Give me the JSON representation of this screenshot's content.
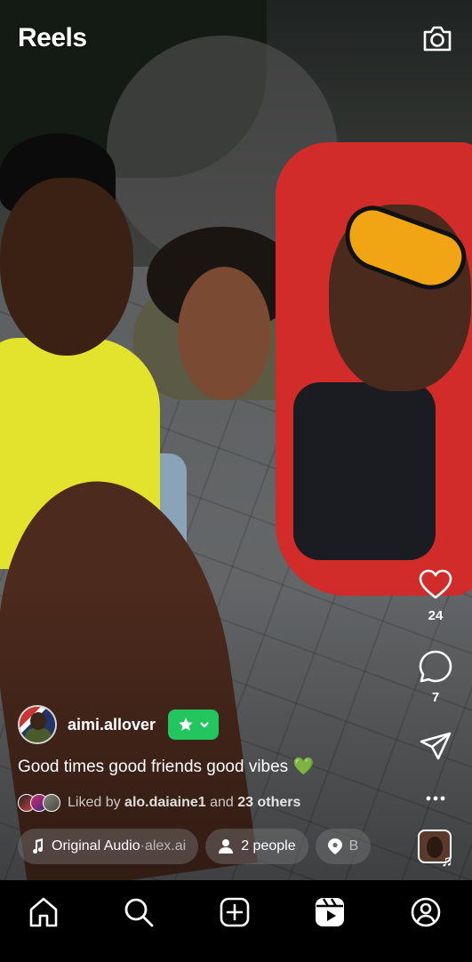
{
  "header": {
    "title": "Reels"
  },
  "actions": {
    "like_count": "24",
    "comment_count": "7"
  },
  "post": {
    "username": "aimi.allover",
    "caption": "Good times good friends good vibes",
    "caption_emoji": "💚",
    "liked_prefix": "Liked by",
    "liked_user": "alo.daiaine1",
    "liked_and": "and",
    "liked_others": "23 others"
  },
  "chips": {
    "audio_label": "Original Audio",
    "audio_separator": " · ",
    "audio_artist": "alex.ai",
    "people_label": "2 people",
    "location_label": "B"
  },
  "colors": {
    "badge_green": "#22c55e",
    "heart_green": "#3ecf4b"
  },
  "icons": {
    "header": "camera-icon",
    "rail": [
      "heart-icon",
      "comment-icon",
      "share-icon",
      "more-icon"
    ],
    "nav": [
      "home-icon",
      "search-icon",
      "create-icon",
      "reels-icon",
      "profile-icon"
    ]
  }
}
